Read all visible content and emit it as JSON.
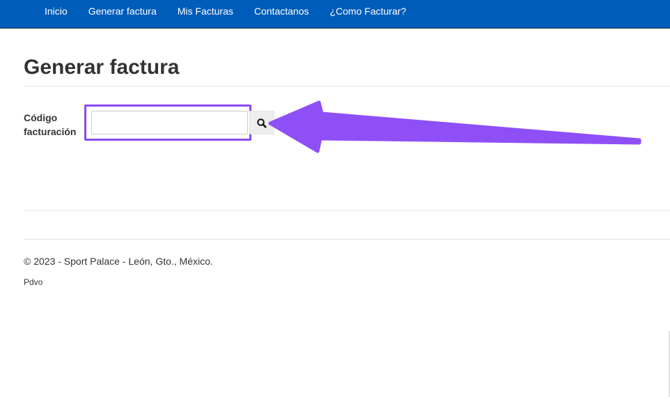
{
  "navbar": {
    "items": [
      {
        "label": "Inicio"
      },
      {
        "label": "Generar factura"
      },
      {
        "label": "Mis Facturas"
      },
      {
        "label": "Contactanos"
      },
      {
        "label": "¿Como Facturar?"
      }
    ]
  },
  "main": {
    "title": "Generar factura",
    "form": {
      "label_line1": "Código",
      "label_line2": "facturación",
      "input_value": "",
      "input_placeholder": "",
      "search_icon": "search-icon"
    }
  },
  "annotation": {
    "highlight_color": "#8a4af3",
    "arrow_color": "#8f4ff7"
  },
  "footer": {
    "copyright": "© 2023 - Sport Palace - León, Gto., México.",
    "sub": "Pdvo"
  },
  "colors": {
    "navbar_bg": "#005cb9",
    "text": "#333333"
  }
}
